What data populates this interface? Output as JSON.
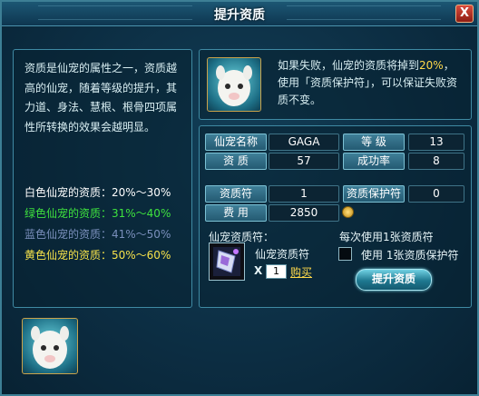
{
  "window": {
    "title": "提升资质",
    "close_label": "X"
  },
  "description": "资质是仙宠的属性之一，资质越高的仙宠，随着等级的提升，其力道、身法、慧根、根骨四项属性所转换的效果会越明显。",
  "rates": [
    {
      "text": "白色仙宠的资质：20%～30%",
      "color": "#ffffff"
    },
    {
      "text": "绿色仙宠的资质：31%～40%",
      "color": "#3ee23e"
    },
    {
      "text": "蓝色仙宠的资质：41%～50%",
      "color": "#7a8fbc"
    },
    {
      "text": "黄色仙宠的资质：50%～60%",
      "color": "#f6e24a"
    }
  ],
  "warning": {
    "part1": "如果失败，仙宠的资质将掉到",
    "highlight": "20%",
    "part2": "，使用「资质保护符」，可以保证失败资质不变。"
  },
  "stats": {
    "name_label": "仙宠名称",
    "name_value": "GAGA",
    "level_label": "等  级",
    "level_value": "13",
    "aptitude_label": "资  质",
    "aptitude_value": "57",
    "success_label": "成功率",
    "success_value": "8"
  },
  "materials": {
    "talisman_label": "资质符",
    "talisman_value": "1",
    "protect_label": "资质保护符",
    "protect_value": "0",
    "cost_label": "费  用",
    "cost_value": "2850"
  },
  "item_section": {
    "heading": "仙宠资质符：",
    "item_name": "仙宠资质符",
    "qty_prefix": "X",
    "qty": "1",
    "buy_label": "购买"
  },
  "protect_section": {
    "heading": "每次使用1张资质符",
    "checkbox_label": "使用 1张资质保护符",
    "checked": false
  },
  "action": {
    "label": "提升资质"
  },
  "colors": {
    "accent": "#3f8aa3",
    "highlight": "#ffd94a",
    "button": "#1f7890"
  },
  "icons": {
    "pet_avatar": "white-alpaca-icon",
    "item": "talisman-icon",
    "coin": "coin-icon"
  }
}
